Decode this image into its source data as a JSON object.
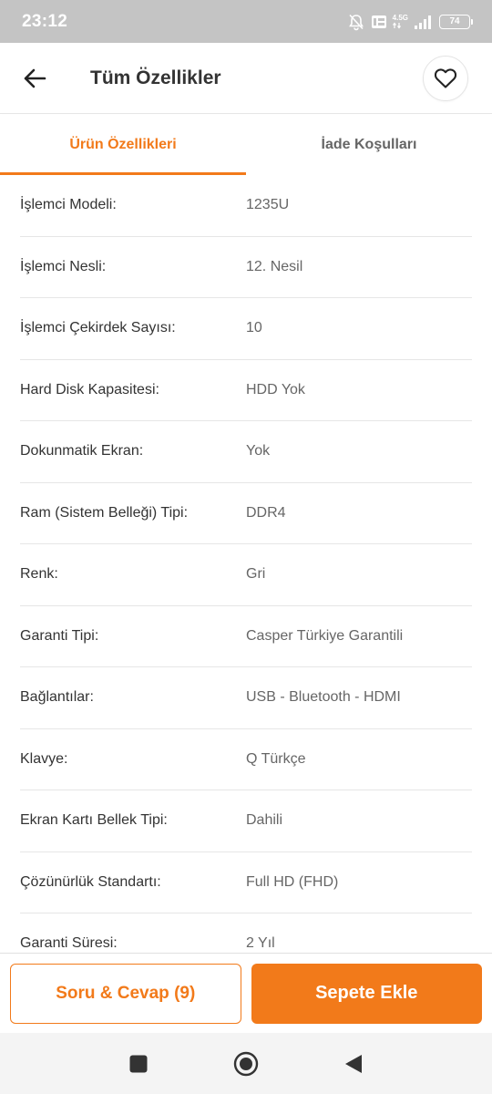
{
  "status_bar": {
    "time": "23:12",
    "network": "4.5G",
    "battery": "74"
  },
  "header": {
    "title": "Tüm Özellikler"
  },
  "tabs": [
    {
      "label": "Ürün Özellikleri",
      "active": true
    },
    {
      "label": "İade Koşulları",
      "active": false
    }
  ],
  "specs": [
    {
      "key": "İşlemci Modeli:",
      "value": "1235U"
    },
    {
      "key": "İşlemci Nesli:",
      "value": "12. Nesil"
    },
    {
      "key": "İşlemci Çekirdek Sayısı:",
      "value": "10"
    },
    {
      "key": "Hard Disk Kapasitesi:",
      "value": "HDD Yok"
    },
    {
      "key": "Dokunmatik Ekran:",
      "value": "Yok"
    },
    {
      "key": "Ram (Sistem Belleği) Tipi:",
      "value": "DDR4"
    },
    {
      "key": "Renk:",
      "value": "Gri"
    },
    {
      "key": "Garanti Tipi:",
      "value": "Casper Türkiye Garantili"
    },
    {
      "key": "Bağlantılar:",
      "value": "USB - Bluetooth - HDMI"
    },
    {
      "key": "Klavye:",
      "value": "Q Türkçe"
    },
    {
      "key": "Ekran Kartı Bellek Tipi:",
      "value": "Dahili"
    },
    {
      "key": "Çözünürlük Standartı:",
      "value": "Full HD (FHD)"
    },
    {
      "key": "Garanti Süresi:",
      "value": "2 Yıl"
    }
  ],
  "bottom_bar": {
    "qa_label": "Soru & Cevap (9)",
    "add_to_cart_label": "Sepete Ekle"
  },
  "colors": {
    "accent": "#f27a1a",
    "status_bar": "#c4c4c4"
  },
  "icons": {
    "back": "arrow-left-icon",
    "favorite": "heart-icon",
    "nav_recents": "square-icon",
    "nav_home": "circle-icon",
    "nav_back": "triangle-back-icon"
  }
}
